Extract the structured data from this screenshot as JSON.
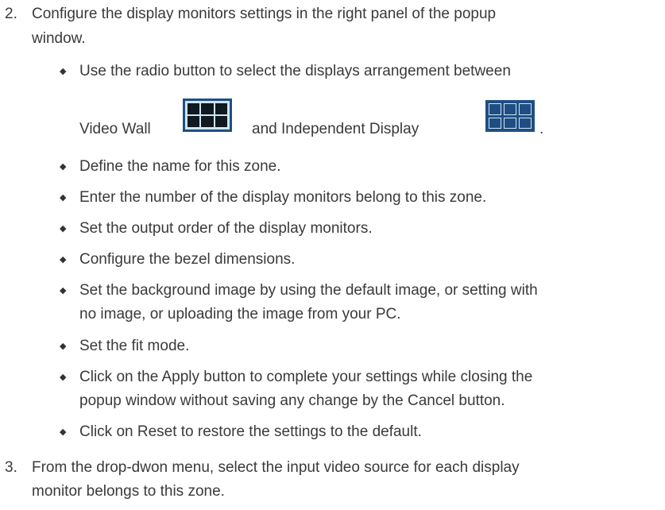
{
  "step2": {
    "number": "2.",
    "line1": "Configure the display monitors settings in the right panel of the popup",
    "line2": "window."
  },
  "bullets": {
    "radio_line1": "Use the radio button to select the displays arrangement between",
    "radio_videowall": "Video Wall",
    "radio_and": "and Independent Display",
    "radio_period": ".",
    "name": "Define the name for this zone.",
    "number": "Enter the number of the display monitors belong to this zone.",
    "order": "Set the output order of the display monitors.",
    "bezel": "Configure the bezel dimensions.",
    "bg_line1": "Set the background image by using the default image, or setting with",
    "bg_line2": "no image, or uploading the image from your PC.",
    "fit": "Set the fit mode.",
    "apply_line1": "Click on the Apply button to complete your settings while closing the",
    "apply_line2": "popup window without saving any change by the Cancel button.",
    "reset": "Click on Reset to restore the settings to the default."
  },
  "step3": {
    "number": "3.",
    "line1": "From the drop-dwon menu, select the input video source for each display",
    "line2": "monitor belongs to this zone."
  },
  "icons": {
    "bullet": "diamond-bullet-icon",
    "video_wall": "video-wall-icon",
    "independent": "independent-display-icon",
    "accent": "#1f4f82"
  }
}
